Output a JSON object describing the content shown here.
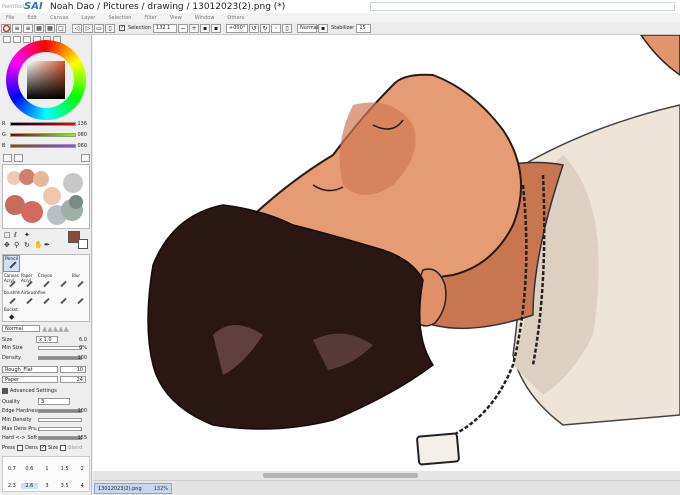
{
  "app": {
    "logo": "PaintTool",
    "brand": "SAI",
    "title": "Noah Dao / Pictures / drawing / 13012023(2).png (*)"
  },
  "menu": [
    "File",
    "Edit",
    "Canvas",
    "Layer",
    "Selection",
    "Filter",
    "View",
    "Window",
    "Others"
  ],
  "toolbar": {
    "selection_label": "Selection",
    "zoom_value": "132.1",
    "angle_value": "+000°",
    "blend_mode": "Normal",
    "stabilizer_label": "Stabilizer",
    "stabilizer_value": "15"
  },
  "color": {
    "r_label": "R",
    "r_value": "136",
    "g_label": "G",
    "g_value": "080",
    "b_label": "B",
    "b_value": "060",
    "current": "#884c3a",
    "swatches": [
      "#f0c8b8",
      "#d08070",
      "#e5b89a",
      "#c8c8c8",
      "#d46a5e",
      "#9fb0a8",
      "#b46450",
      "#f2c6ae",
      "#e8e8e8",
      "#c76b5a",
      "#7a8a82",
      "#b8c0c4"
    ]
  },
  "tools": {
    "items": [
      {
        "label": "Pencil",
        "icon": "pencil-icon",
        "active": true
      },
      {
        "label": "Canvas",
        "icon": "canvas-brush-icon"
      },
      {
        "label": "Paper",
        "icon": "paper-brush-icon"
      },
      {
        "label": "Crayon",
        "icon": "crayon-icon"
      },
      {
        "label": "Blur",
        "icon": "blur-icon"
      },
      {
        "label": "Acryl",
        "icon": "acrylic-icon"
      },
      {
        "label": "Acryl",
        "icon": "acrylic-icon"
      },
      {
        "label": "",
        "icon": "brush-icon"
      },
      {
        "label": "",
        "icon": "brush-icon"
      },
      {
        "label": "brushhh",
        "icon": "brush-icon"
      },
      {
        "label": "Airbrush",
        "icon": "airbrush-icon"
      },
      {
        "label": "fine",
        "icon": "fine-brush-icon"
      },
      {
        "label": "",
        "icon": "brush-icon"
      },
      {
        "label": "",
        "icon": "brush-icon"
      },
      {
        "label": "Bucket",
        "icon": "bucket-icon"
      }
    ]
  },
  "brush": {
    "blend_mode": "Normal",
    "size_label": "Size",
    "size_multiplier": "x 1.0",
    "size_value": "6.0",
    "min_size_label": "Min Size",
    "min_size_value": "0%",
    "density_label": "Density",
    "density_value": "100",
    "texture_name": "Rough_Flat",
    "texture_value": "10",
    "paper_name": "Paper",
    "paper_value": "24",
    "advanced_label": "Advanced Settings",
    "quality_label": "Quality",
    "quality_value": "3",
    "edge_hardness_label": "Edge Hardness",
    "edge_hardness_value": "100",
    "min_density_label": "Min Density",
    "min_density_value": "",
    "max_dens_prs_label": "Max Dens Prs.",
    "max_dens_prs_value": "",
    "hard_soft_label": "Hard <-> Soft",
    "hard_soft_value": "155",
    "press_label": "Press",
    "dens_label": "Dens",
    "size_check_label": "Size",
    "blend_label": "Blend",
    "size_presets_row1": [
      "0.7",
      "0.6",
      "1",
      "1.5",
      "2"
    ],
    "size_presets_row2": [
      "2.3",
      "2.6",
      "3",
      "3.5",
      "4"
    ]
  },
  "status": {
    "doc_name": "13012023(2).png",
    "zoom": "132%"
  }
}
